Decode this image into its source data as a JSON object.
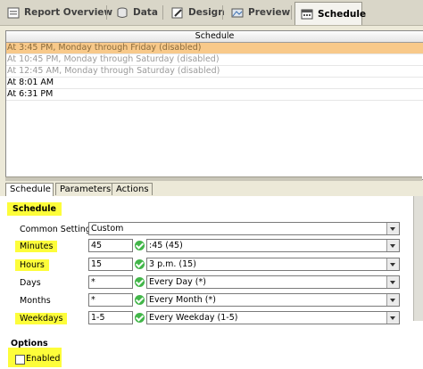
{
  "tabs": [
    {
      "label": "Report Overview"
    },
    {
      "label": "Data"
    },
    {
      "label": "Design"
    },
    {
      "label": "Preview"
    },
    {
      "label": "Schedule"
    }
  ],
  "schedule_list": {
    "header": "Schedule",
    "rows": [
      {
        "text": "At 3:45 PM, Monday through Friday (disabled)"
      },
      {
        "text": "At 10:45 PM, Monday through Saturday (disabled)"
      },
      {
        "text": "At 12:45 AM, Monday through Saturday (disabled)"
      },
      {
        "text": "At 8:01 AM"
      },
      {
        "text": "At 6:31 PM"
      }
    ]
  },
  "subtabs": [
    "Schedule",
    "Parameters",
    "Actions"
  ],
  "schedule_section": {
    "title": "Schedule",
    "common_settings": {
      "label": "Common Settings",
      "value": "Custom"
    },
    "fields": [
      {
        "label": "Minutes",
        "value": "45",
        "option": ":45 (45)"
      },
      {
        "label": "Hours",
        "value": "15",
        "option": "3 p.m. (15)"
      },
      {
        "label": "Days",
        "value": "*",
        "option": "Every Day (*)"
      },
      {
        "label": "Months",
        "value": "*",
        "option": "Every Month (*)"
      },
      {
        "label": "Weekdays",
        "value": "1-5",
        "option": "Every Weekday (1-5)"
      }
    ]
  },
  "options_section": {
    "title": "Options",
    "enabled_label": "Enabled",
    "enabled": false
  },
  "colors": {
    "highlight": "#fdfd3a",
    "selected_row": "#f8c98a",
    "check_green": "#42b649"
  }
}
